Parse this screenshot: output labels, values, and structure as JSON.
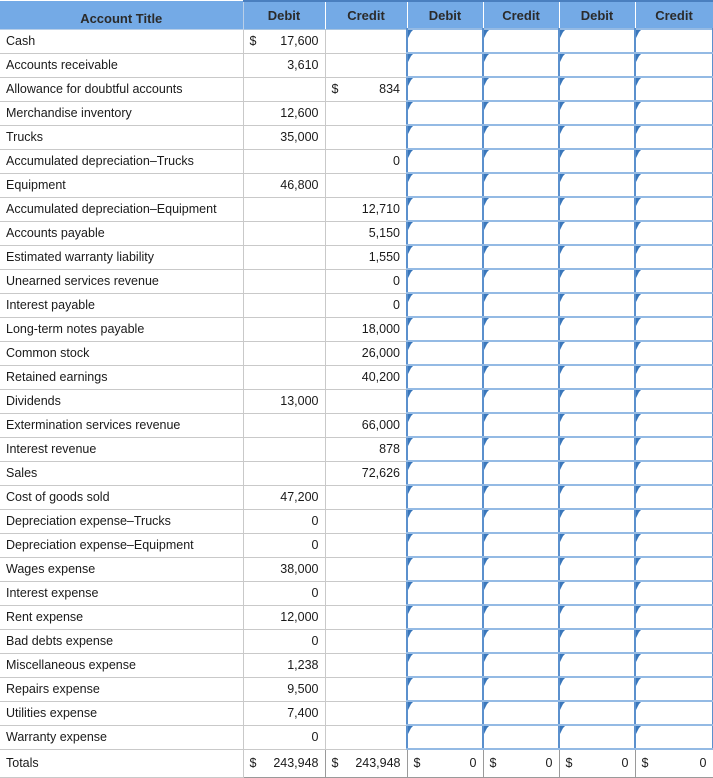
{
  "worksheet": {
    "title_header": "Account Title",
    "column_groups_headers": [
      "Debit",
      "Credit",
      "Debit",
      "Credit",
      "Debit",
      "Credit"
    ],
    "currency_symbol": "$",
    "colors": {
      "header_blue": "#74aae6",
      "entry_border_blue": "#5b90cd",
      "marker_blue": "#2f6fb5",
      "grid_gray": "#c9c9c9",
      "text": "#1a1a1a"
    },
    "rows": [
      {
        "account": "Cash",
        "debit": "17,600",
        "credit": "",
        "debit_cur": "$",
        "credit_cur": ""
      },
      {
        "account": "Accounts receivable",
        "debit": "3,610",
        "credit": "",
        "debit_cur": "",
        "credit_cur": ""
      },
      {
        "account": "Allowance for doubtful accounts",
        "debit": "",
        "credit": "834",
        "debit_cur": "",
        "credit_cur": "$"
      },
      {
        "account": "Merchandise inventory",
        "debit": "12,600",
        "credit": "",
        "debit_cur": "",
        "credit_cur": ""
      },
      {
        "account": "Trucks",
        "debit": "35,000",
        "credit": "",
        "debit_cur": "",
        "credit_cur": ""
      },
      {
        "account": "Accumulated depreciation–Trucks",
        "debit": "",
        "credit": "0",
        "debit_cur": "",
        "credit_cur": ""
      },
      {
        "account": "Equipment",
        "debit": "46,800",
        "credit": "",
        "debit_cur": "",
        "credit_cur": ""
      },
      {
        "account": "Accumulated depreciation–Equipment",
        "debit": "",
        "credit": "12,710",
        "debit_cur": "",
        "credit_cur": ""
      },
      {
        "account": "Accounts payable",
        "debit": "",
        "credit": "5,150",
        "debit_cur": "",
        "credit_cur": ""
      },
      {
        "account": "Estimated warranty liability",
        "debit": "",
        "credit": "1,550",
        "debit_cur": "",
        "credit_cur": ""
      },
      {
        "account": "Unearned services revenue",
        "debit": "",
        "credit": "0",
        "debit_cur": "",
        "credit_cur": ""
      },
      {
        "account": "Interest payable",
        "debit": "",
        "credit": "0",
        "debit_cur": "",
        "credit_cur": ""
      },
      {
        "account": "Long-term notes payable",
        "debit": "",
        "credit": "18,000",
        "debit_cur": "",
        "credit_cur": ""
      },
      {
        "account": "Common stock",
        "debit": "",
        "credit": "26,000",
        "debit_cur": "",
        "credit_cur": ""
      },
      {
        "account": "Retained earnings",
        "debit": "",
        "credit": "40,200",
        "debit_cur": "",
        "credit_cur": ""
      },
      {
        "account": "Dividends",
        "debit": "13,000",
        "credit": "",
        "debit_cur": "",
        "credit_cur": ""
      },
      {
        "account": "Extermination services revenue",
        "debit": "",
        "credit": "66,000",
        "debit_cur": "",
        "credit_cur": ""
      },
      {
        "account": "Interest revenue",
        "debit": "",
        "credit": "878",
        "debit_cur": "",
        "credit_cur": ""
      },
      {
        "account": "Sales",
        "debit": "",
        "credit": "72,626",
        "debit_cur": "",
        "credit_cur": ""
      },
      {
        "account": "Cost of goods sold",
        "debit": "47,200",
        "credit": "",
        "debit_cur": "",
        "credit_cur": ""
      },
      {
        "account": "Depreciation expense–Trucks",
        "debit": "0",
        "credit": "",
        "debit_cur": "",
        "credit_cur": ""
      },
      {
        "account": "Depreciation expense–Equipment",
        "debit": "0",
        "credit": "",
        "debit_cur": "",
        "credit_cur": ""
      },
      {
        "account": "Wages expense",
        "debit": "38,000",
        "credit": "",
        "debit_cur": "",
        "credit_cur": ""
      },
      {
        "account": "Interest expense",
        "debit": "0",
        "credit": "",
        "debit_cur": "",
        "credit_cur": ""
      },
      {
        "account": "Rent expense",
        "debit": "12,000",
        "credit": "",
        "debit_cur": "",
        "credit_cur": ""
      },
      {
        "account": "Bad debts expense",
        "debit": "0",
        "credit": "",
        "debit_cur": "",
        "credit_cur": ""
      },
      {
        "account": "Miscellaneous expense",
        "debit": "1,238",
        "credit": "",
        "debit_cur": "",
        "credit_cur": ""
      },
      {
        "account": "Repairs expense",
        "debit": "9,500",
        "credit": "",
        "debit_cur": "",
        "credit_cur": ""
      },
      {
        "account": "Utilities expense",
        "debit": "7,400",
        "credit": "",
        "debit_cur": "",
        "credit_cur": ""
      },
      {
        "account": "Warranty expense",
        "debit": "0",
        "credit": "",
        "debit_cur": "",
        "credit_cur": ""
      }
    ],
    "totals": {
      "label": "Totals",
      "debit": "243,948",
      "credit": "243,948",
      "debit_cur": "$",
      "credit_cur": "$",
      "entry_values": [
        "0",
        "0",
        "0",
        "0"
      ],
      "entry_currency": [
        "$",
        "$",
        "$",
        "$"
      ]
    }
  }
}
